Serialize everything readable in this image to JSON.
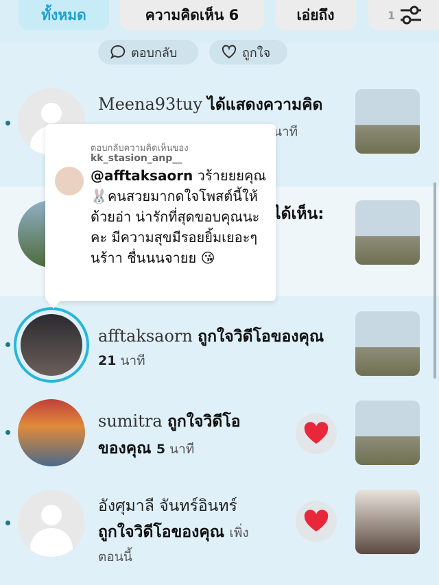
{
  "tabs": [
    {
      "label": "ทั้งหมด",
      "active": true
    },
    {
      "label": "ความคิดเห็น 6",
      "active": false
    },
    {
      "label": "เอ่ยถึง",
      "active": false
    },
    {
      "label": "1",
      "active": false
    }
  ],
  "actions": {
    "reply": "ตอบกลับ",
    "like": "ถูกใจ"
  },
  "rows": [
    {
      "name": "Meena93tuy",
      "action": "ได้แสดงความคิด",
      "time": "นาที"
    },
    {
      "name": "",
      "action": "ได้เห็น:",
      "time": ""
    },
    {
      "name": "afftaksaorn",
      "action": "ถูกใจวิดีโอของคุณ",
      "time_num": "21",
      "time_unit": "นาที"
    },
    {
      "name": "sumitra",
      "action": "ถูกใจวิดีโอ",
      "action2": "ของคุณ",
      "time_num": "5",
      "time_unit": "นาที"
    },
    {
      "name": "อังศุมาลี จันทร์อินทร์",
      "action": "ถูกใจวิดีโอของคุณ",
      "time_inline": "เพิ่ง",
      "time_line2": "ตอนนี้"
    }
  ],
  "popup": {
    "header": "ตอบกลับความคิดเห็นของ",
    "username": "kk_stasion_anp__",
    "mention": "@afftaksaorn",
    "body": "วร้ายยยคุณ 🐰คนสวยมากดใจโพสต์นี้ให้ด้วยอ่า น่ารักที่สุดขอบคุณนะคะ มีความสุขมีรอยยิ้มเยอะๆนร้าา ชื่นนนจายย 😘"
  },
  "colors": {
    "accent": "#1ea0cf",
    "heart": "#e8283a",
    "background": "#dff0f8"
  }
}
